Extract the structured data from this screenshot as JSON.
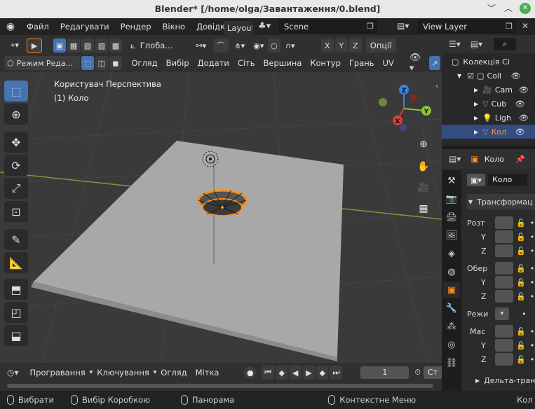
{
  "window": {
    "title": "Blender* [/home/olga/Завантаження/0.blend]"
  },
  "menu": {
    "items": [
      "Файл",
      "Редагувати",
      "Рендер",
      "Вікно",
      "Довідка"
    ],
    "workspace_tab": "Layout"
  },
  "scene": {
    "name": "Scene",
    "view_layer": "View Layer"
  },
  "viewport": {
    "transform_orientation": "Глоба...",
    "mode": "Режим Реда...",
    "options_label": "Опції",
    "axes": [
      "X",
      "Y",
      "Z"
    ],
    "header_menu": [
      "Огляд",
      "Вибір",
      "Додати",
      "Сіть",
      "Вершина",
      "Контур",
      "Грань",
      "UV"
    ],
    "view_name": "Користувач Перспектива",
    "object_info": "(1) Коло",
    "gizmo": {
      "x": "X",
      "y": "Y",
      "z": "Z"
    }
  },
  "outliner": {
    "items": [
      {
        "label": "Колекція Сі",
        "icon": "collection-icon"
      },
      {
        "label": "Coll",
        "icon": "collection-icon"
      },
      {
        "label": "Cam",
        "icon": "camera-icon"
      },
      {
        "label": "Cub",
        "icon": "mesh-icon"
      },
      {
        "label": "Ligh",
        "icon": "light-icon"
      },
      {
        "label": "Кол",
        "icon": "mesh-icon"
      }
    ]
  },
  "properties": {
    "object_name": "Коло",
    "object_field": "Коло",
    "panel": "Трансформац",
    "location_label": "Розт",
    "rotation_label": "Обер",
    "mode_label": "Режи",
    "scale_label": "Мас",
    "axis_y": "Y",
    "axis_z": "Z",
    "delta_panel": "Дельта-тран"
  },
  "timeline": {
    "menu": [
      "Програвання",
      "Ключування",
      "Огляд",
      "Мітка"
    ],
    "current_frame": "1",
    "start_label": "Ст"
  },
  "status": {
    "select": "Вибрати",
    "box_select": "Вибір Коробкою",
    "pan": "Панорама",
    "context_menu": "Контекстне Меню",
    "right_cut": "Кол"
  },
  "colors": {
    "accent": "#4772b3",
    "orange": "#ff8c1a",
    "grid": "#444444",
    "x_axis": "#e03c3c",
    "y_axis": "#8cc43a",
    "z_axis": "#3c82e0"
  }
}
